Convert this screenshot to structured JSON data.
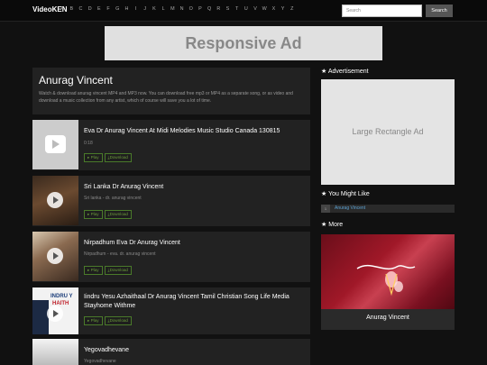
{
  "nav": {
    "brand": "VideoKEN",
    "letters": [
      "A",
      "B",
      "C",
      "D",
      "E",
      "F",
      "G",
      "H",
      "I",
      "J",
      "K",
      "L",
      "M",
      "N",
      "O",
      "P",
      "Q",
      "R",
      "S",
      "T",
      "U",
      "V",
      "W",
      "X",
      "Y",
      "Z"
    ],
    "search_placeholder": "Search",
    "search_button": "Search"
  },
  "ad_banner": "Responsive Ad",
  "header": {
    "title": "Anurag Vincent",
    "description": "Watch & download anurag vincent MP4 and MP3 now. You can download free mp3 or MP4 as a separate song, or as video and download a music collection from any artist, which of course will save you a lot of time."
  },
  "videos": [
    {
      "title": "Eva Dr Anurag Vincent At Midi Melodies Music Studio Canada 130815",
      "subtitle": "0:18",
      "play": "Play",
      "download": "Download"
    },
    {
      "title": "Sri Lanka Dr Anurag Vincent",
      "subtitle": "Sri lanka - dr. anurag vincent",
      "play": "Play",
      "download": "Download"
    },
    {
      "title": "Nirpadhum Eva Dr Anurag Vincent",
      "subtitle": "Nirpadhum - eva. dr. anurag vincent",
      "play": "Play",
      "download": "Download"
    },
    {
      "title": "Iindru Yesu Azhaithaal Dr Anurag Vincent Tamil Christian Song Life Media Stayhome Withme",
      "subtitle": "",
      "play": "Play",
      "download": "Download"
    },
    {
      "title": "Yegovadhevane",
      "subtitle": "Yegovadhevane",
      "play": "Play",
      "download": "Download"
    }
  ],
  "sidebar": {
    "ad_heading": "Advertisement",
    "ad_box": "Large Rectangle Ad",
    "like_heading": "You Might Like",
    "like_number": "1",
    "like_link": "Anurag Vincent",
    "more_heading": "More",
    "more_caption": "Anurag Vincent"
  },
  "thumb_texts": {
    "v4_line1": "INDRU Y",
    "v4_line2": "HAITH"
  },
  "colors": {
    "background": "#111111",
    "panel": "#222222",
    "button_green": "#6a9a3a",
    "link_blue": "#5aa0d0"
  }
}
